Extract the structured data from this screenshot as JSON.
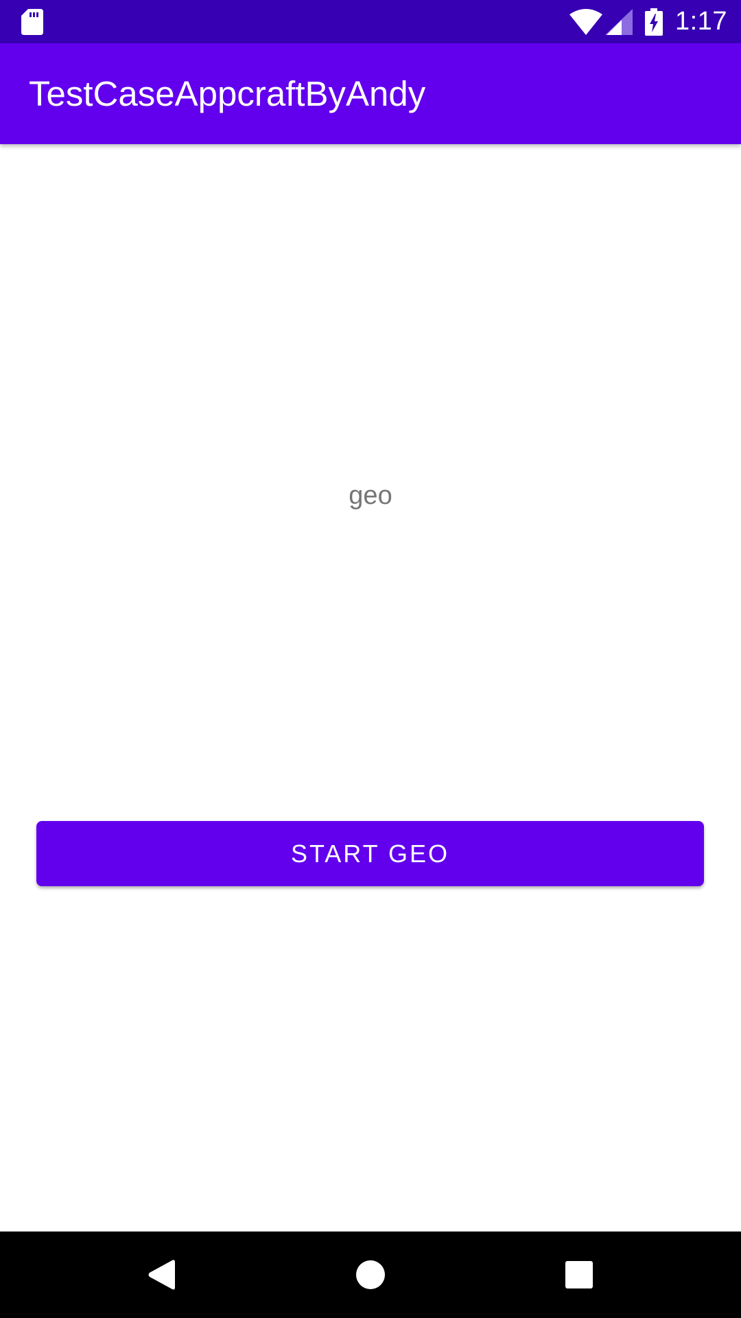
{
  "status_bar": {
    "time": "1:17",
    "background": "#3700b3",
    "icons": [
      "sd-card-icon",
      "wifi-icon",
      "signal-icon",
      "battery-charging-icon"
    ]
  },
  "app_bar": {
    "title": "TestCaseAppcraftByAndy",
    "background": "#6200ee"
  },
  "main": {
    "status_text": "geo",
    "start_button_label": "START GEO",
    "button_color": "#6200ee"
  },
  "nav_bar": {
    "icons": [
      "back-icon",
      "home-icon",
      "recents-icon"
    ]
  }
}
